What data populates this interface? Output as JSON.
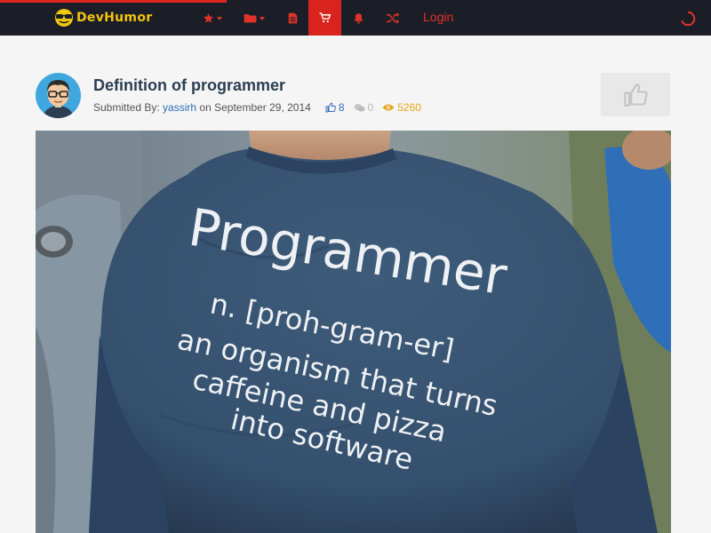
{
  "nav": {
    "logo_text": "DevHumor",
    "icons": [
      "star-icon",
      "folder-icon",
      "file-icon",
      "cart-icon",
      "bell-icon",
      "shuffle-icon"
    ],
    "login_label": "Login",
    "accent_color": "#e0332a",
    "active_color": "#d9231d",
    "bar_color": "#1b1e26"
  },
  "post": {
    "title": "Definition of programmer",
    "submitted_label": "Submitted By:",
    "author": "yassirh",
    "date_text": "on September 29, 2014",
    "likes": "8",
    "comments": "0",
    "views": "5260"
  },
  "image": {
    "shirt_lines": [
      "Programmer",
      "n. [proh-gram-er]",
      "an organism that turns",
      "caffeine and pizza",
      "into software"
    ]
  }
}
